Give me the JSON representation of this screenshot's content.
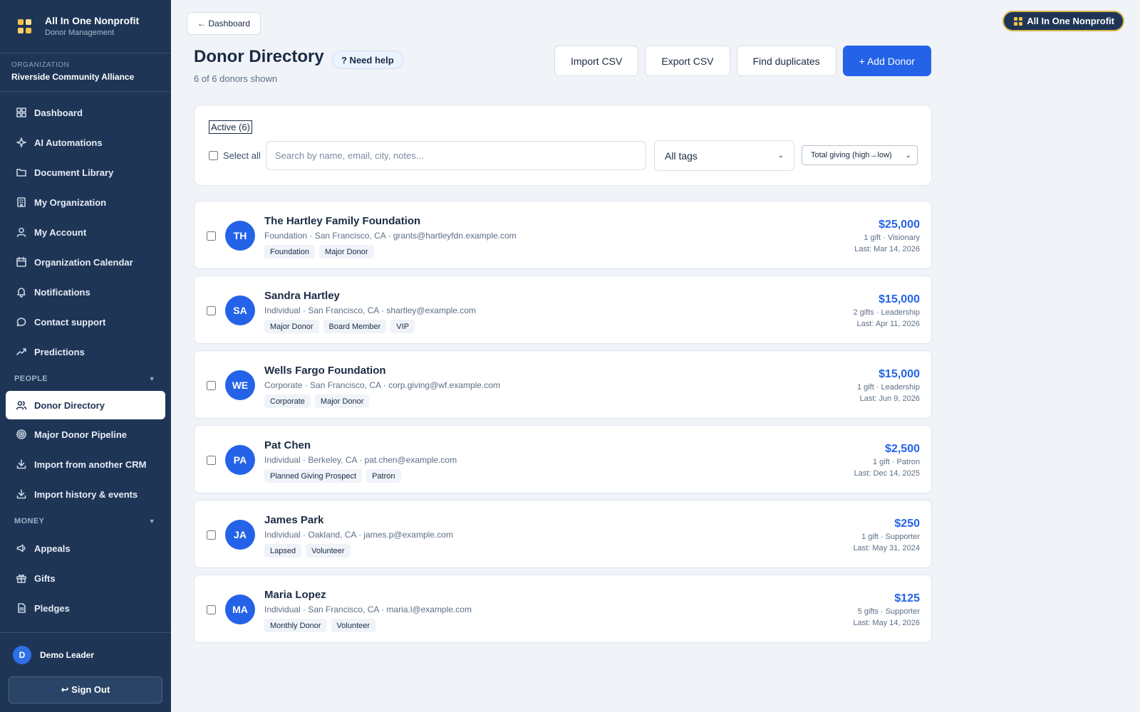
{
  "app": {
    "title": "All In One Nonprofit",
    "subtitle": "Donor Management"
  },
  "organization": {
    "label": "ORGANIZATION",
    "name": "Riverside Community Alliance"
  },
  "nav": {
    "main": [
      {
        "label": "Dashboard",
        "icon": "dashboard-icon"
      },
      {
        "label": "AI Automations",
        "icon": "sparkle-icon"
      },
      {
        "label": "Document Library",
        "icon": "folder-icon"
      },
      {
        "label": "My Organization",
        "icon": "building-icon"
      },
      {
        "label": "My Account",
        "icon": "user-icon"
      },
      {
        "label": "Organization Calendar",
        "icon": "calendar-icon"
      },
      {
        "label": "Notifications",
        "icon": "bell-icon"
      },
      {
        "label": "Contact support",
        "icon": "chat-icon"
      },
      {
        "label": "Predictions",
        "icon": "trend-icon"
      }
    ],
    "people_section": "PEOPLE",
    "people": [
      {
        "label": "Donor Directory",
        "icon": "users-icon",
        "active": true
      },
      {
        "label": "Major Donor Pipeline",
        "icon": "target-icon"
      },
      {
        "label": "Import from another CRM",
        "icon": "download-icon"
      },
      {
        "label": "Import history & events",
        "icon": "download-icon"
      }
    ],
    "money_section": "MONEY",
    "money": [
      {
        "label": "Appeals",
        "icon": "megaphone-icon"
      },
      {
        "label": "Gifts",
        "icon": "gift-icon"
      },
      {
        "label": "Pledges",
        "icon": "document-icon"
      }
    ]
  },
  "user": {
    "initial": "D",
    "name": "Demo Leader",
    "signout": "↩ Sign Out"
  },
  "header": {
    "back": "← Dashboard",
    "badge": "All In One Nonprofit",
    "title": "Donor Directory",
    "help": "? Need help",
    "count_text": "6 of 6 donors shown"
  },
  "actions": {
    "import": "Import CSV",
    "export": "Export CSV",
    "duplicates": "Find duplicates",
    "add": "+ Add Donor"
  },
  "filters": {
    "active_tab": "Active (6)",
    "select_all": "Select all",
    "search_placeholder": "Search by name, email, city, notes...",
    "tag_select": "All tags",
    "sort_select": "Total giving (high→low)"
  },
  "donors": [
    {
      "initials": "TH",
      "name": "The Hartley Family Foundation",
      "meta": "Foundation · San Francisco, CA · grants@hartleyfdn.example.com",
      "tags": [
        "Foundation",
        "Major Donor"
      ],
      "amount": "$25,000",
      "gifts": "1 gift · Visionary",
      "last": "Last: Mar 14, 2026"
    },
    {
      "initials": "SA",
      "name": "Sandra Hartley",
      "meta": "Individual · San Francisco, CA · shartley@example.com",
      "tags": [
        "Major Donor",
        "Board Member",
        "VIP"
      ],
      "amount": "$15,000",
      "gifts": "2 gifts · Leadership",
      "last": "Last: Apr 11, 2026"
    },
    {
      "initials": "WE",
      "name": "Wells Fargo Foundation",
      "meta": "Corporate · San Francisco, CA · corp.giving@wf.example.com",
      "tags": [
        "Corporate",
        "Major Donor"
      ],
      "amount": "$15,000",
      "gifts": "1 gift · Leadership",
      "last": "Last: Jun 9, 2026"
    },
    {
      "initials": "PA",
      "name": "Pat Chen",
      "meta": "Individual · Berkeley, CA · pat.chen@example.com",
      "tags": [
        "Planned Giving Prospect",
        "Patron"
      ],
      "amount": "$2,500",
      "gifts": "1 gift · Patron",
      "last": "Last: Dec 14, 2025"
    },
    {
      "initials": "JA",
      "name": "James Park",
      "meta": "Individual · Oakland, CA · james.p@example.com",
      "tags": [
        "Lapsed",
        "Volunteer"
      ],
      "amount": "$250",
      "gifts": "1 gift · Supporter",
      "last": "Last: May 31, 2024"
    },
    {
      "initials": "MA",
      "name": "Maria Lopez",
      "meta": "Individual · San Francisco, CA · maria.l@example.com",
      "tags": [
        "Monthly Donor",
        "Volunteer"
      ],
      "amount": "$125",
      "gifts": "5 gifts · Supporter",
      "last": "Last: May 14, 2026"
    }
  ],
  "colors": {
    "sidebar": "#1e3556",
    "accent": "#2463e8",
    "brand_gold": "#f3c14b"
  }
}
